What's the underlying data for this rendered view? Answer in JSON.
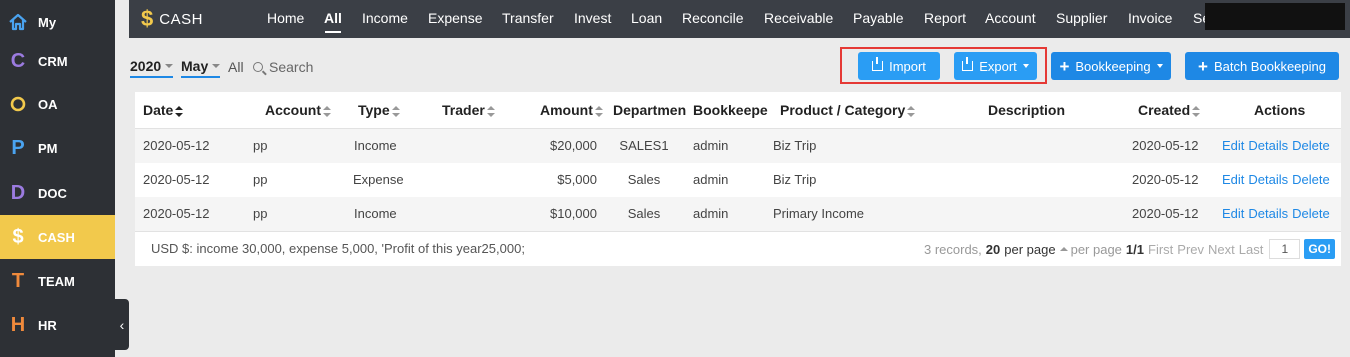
{
  "sidebar": {
    "items": [
      {
        "label": "My",
        "icon": "home-icon",
        "glyph": "⌂",
        "color": "#4aa3f0"
      },
      {
        "label": "CRM",
        "icon": "crm-letter-icon",
        "glyph": "C",
        "color": "#9b7be0"
      },
      {
        "label": "OA",
        "icon": "oa-circle-icon",
        "glyph": "O",
        "color": "#f2c94c"
      },
      {
        "label": "PM",
        "icon": "pm-letter-icon",
        "glyph": "P",
        "color": "#4aa3f0"
      },
      {
        "label": "DOC",
        "icon": "doc-letter-icon",
        "glyph": "D",
        "color": "#9b7be0"
      },
      {
        "label": "CASH",
        "icon": "dollar-icon",
        "glyph": "$",
        "color": "#ffffff"
      },
      {
        "label": "TEAM",
        "icon": "team-letter-icon",
        "glyph": "T",
        "color": "#f08a3c"
      },
      {
        "label": "HR",
        "icon": "hr-letter-icon",
        "glyph": "H",
        "color": "#f08a3c"
      }
    ],
    "active": "CASH",
    "collapse_glyph": "‹"
  },
  "brand": {
    "icon": "dollar-icon",
    "glyph": "$",
    "name": "CASH"
  },
  "nav": {
    "items": [
      "Home",
      "All",
      "Income",
      "Expense",
      "Transfer",
      "Invest",
      "Loan",
      "Reconcile",
      "Receivable",
      "Payable",
      "Report",
      "Account",
      "Supplier",
      "Invoice",
      "Se"
    ],
    "active": "All"
  },
  "filters": {
    "year": "2020",
    "month": "May",
    "all": "All",
    "search": "Search"
  },
  "toolbar": {
    "import": "Import",
    "export": "Export",
    "bookkeeping": "+ Bookkeeping",
    "bookkeeping_label": "Bookkeeping",
    "batch_bookkeeping": "Batch Bookkeeping"
  },
  "table": {
    "columns": [
      "Date",
      "Account",
      "Type",
      "Trader",
      "Amount",
      "Departmen",
      "Bookkeepe",
      "Product / Category",
      "Description",
      "Created",
      "Actions"
    ],
    "rows": [
      {
        "date": "2020-05-12",
        "account": "pp",
        "type": "Income",
        "trader": "",
        "amount": "$20,000",
        "department": "SALES1",
        "bookkeeper": "admin",
        "category": "Biz Trip",
        "description": "",
        "created": "2020-05-12"
      },
      {
        "date": "2020-05-12",
        "account": "pp",
        "type": "Expense",
        "trader": "",
        "amount": "$5,000",
        "department": "Sales",
        "bookkeeper": "admin",
        "category": "Biz Trip",
        "description": "",
        "created": "2020-05-12"
      },
      {
        "date": "2020-05-12",
        "account": "pp",
        "type": "Income",
        "trader": "",
        "amount": "$10,000",
        "department": "Sales",
        "bookkeeper": "admin",
        "category": "Primary Income",
        "description": "",
        "created": "2020-05-12"
      }
    ],
    "actions": [
      "Edit",
      "Details",
      "Delete"
    ]
  },
  "footer": {
    "summary": "USD $: income 30,000, expense 5,000, 'Profit of this year25,000;",
    "records": "3 records,",
    "per_page_value": "20",
    "per_page_text": "per page",
    "per_page_label": "per page",
    "page": "1/1",
    "first": "First",
    "prev": "Prev",
    "next": "Next",
    "last": "Last",
    "page_input": "1",
    "go": "GO!"
  }
}
